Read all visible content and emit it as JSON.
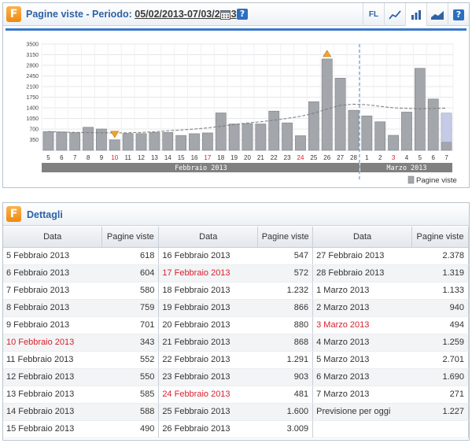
{
  "chart_panel": {
    "title": "Pagine viste - Periodo:",
    "period": "05/02/2013-07/03/2013",
    "fl_label": "FL",
    "legend": "Pagine viste"
  },
  "details_panel": {
    "title": "Dettagli",
    "col_date": "Data",
    "col_views": "Pagine viste",
    "rows": [
      {
        "date": "5 Febbraio 2013",
        "views": "618"
      },
      {
        "date": "6 Febbraio 2013",
        "views": "604"
      },
      {
        "date": "7 Febbraio 2013",
        "views": "580"
      },
      {
        "date": "8 Febbraio 2013",
        "views": "759"
      },
      {
        "date": "9 Febbraio 2013",
        "views": "701"
      },
      {
        "date": "10 Febbraio 2013",
        "views": "343",
        "red": true
      },
      {
        "date": "11 Febbraio 2013",
        "views": "552"
      },
      {
        "date": "12 Febbraio 2013",
        "views": "550"
      },
      {
        "date": "13 Febbraio 2013",
        "views": "585"
      },
      {
        "date": "14 Febbraio 2013",
        "views": "588"
      },
      {
        "date": "15 Febbraio 2013",
        "views": "490"
      },
      {
        "date": "16 Febbraio 2013",
        "views": "547"
      },
      {
        "date": "17 Febbraio 2013",
        "views": "572",
        "red": true
      },
      {
        "date": "18 Febbraio 2013",
        "views": "1.232"
      },
      {
        "date": "19 Febbraio 2013",
        "views": "866"
      },
      {
        "date": "20 Febbraio 2013",
        "views": "880"
      },
      {
        "date": "21 Febbraio 2013",
        "views": "868"
      },
      {
        "date": "22 Febbraio 2013",
        "views": "1.291"
      },
      {
        "date": "23 Febbraio 2013",
        "views": "903"
      },
      {
        "date": "24 Febbraio 2013",
        "views": "481",
        "red": true
      },
      {
        "date": "25 Febbraio 2013",
        "views": "1.600"
      },
      {
        "date": "26 Febbraio 2013",
        "views": "3.009"
      },
      {
        "date": "27 Febbraio 2013",
        "views": "2.378"
      },
      {
        "date": "28 Febbraio 2013",
        "views": "1.319"
      },
      {
        "date": "1 Marzo 2013",
        "views": "1.133"
      },
      {
        "date": "2 Marzo 2013",
        "views": "940"
      },
      {
        "date": "3 Marzo 2013",
        "views": "494",
        "red": true
      },
      {
        "date": "4 Marzo 2013",
        "views": "1.259"
      },
      {
        "date": "5 Marzo 2013",
        "views": "2.701"
      },
      {
        "date": "6 Marzo 2013",
        "views": "1.690"
      },
      {
        "date": "7 Marzo 2013",
        "views": "271"
      },
      {
        "date": "Previsione per oggi",
        "views": "1.227"
      }
    ]
  },
  "chart_data": {
    "type": "bar",
    "categories": [
      "5",
      "6",
      "7",
      "8",
      "9",
      "10",
      "11",
      "12",
      "13",
      "14",
      "15",
      "16",
      "17",
      "18",
      "19",
      "20",
      "21",
      "22",
      "23",
      "24",
      "25",
      "26",
      "27",
      "28",
      "1",
      "2",
      "3",
      "4",
      "5",
      "6",
      "7"
    ],
    "red_categories": [
      5,
      12,
      19,
      26
    ],
    "values": [
      618,
      604,
      580,
      759,
      701,
      343,
      552,
      550,
      585,
      588,
      490,
      547,
      572,
      1232,
      866,
      880,
      868,
      1291,
      903,
      481,
      1600,
      3009,
      2378,
      1319,
      1133,
      940,
      494,
      1259,
      2701,
      1690,
      271
    ],
    "forecast_value": 1227,
    "trend": [
      620,
      600,
      590,
      580,
      575,
      570,
      575,
      590,
      610,
      640,
      670,
      700,
      740,
      790,
      850,
      900,
      940,
      990,
      1050,
      1120,
      1220,
      1360,
      1480,
      1520,
      1500,
      1450,
      1400,
      1380,
      1370,
      1380,
      1390
    ],
    "y_ticks": [
      350,
      700,
      1050,
      1400,
      1750,
      2100,
      2450,
      2800,
      3150,
      3500
    ],
    "ylim": [
      0,
      3500
    ],
    "months": [
      {
        "label": "Febbraio 2013",
        "from": 0,
        "to": 23
      },
      {
        "label": "Marzo 2013",
        "from": 24,
        "to": 30
      }
    ],
    "legend": "Pagine viste",
    "grid": true,
    "colors": {
      "bar": "#a3a6ab",
      "bar_edge": "#7c7f84",
      "forecast": "#c5cae6",
      "trend": "#7a7a7a",
      "month_band": "#808080",
      "marker": "#f0a52a",
      "divider": "#6b9ad6"
    }
  }
}
